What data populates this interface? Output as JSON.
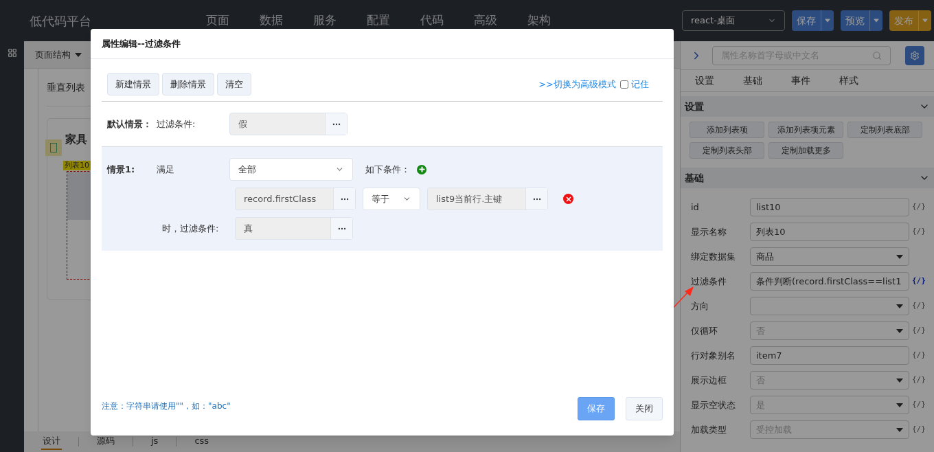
{
  "app": {
    "logo": "低代码平台",
    "nav": [
      "页面",
      "数据",
      "服务",
      "配置",
      "代码",
      "高级",
      "架构"
    ],
    "target_select": "react-桌面",
    "actions": [
      {
        "label": "保存",
        "kind": "primary"
      },
      {
        "label": "预览",
        "kind": "primary"
      },
      {
        "label": "发布",
        "kind": "warning"
      }
    ]
  },
  "toolbar": {
    "structure_menu": "页面结构"
  },
  "canvas": {
    "title": "垂直列表",
    "card_title": "家具",
    "list_tag": "列表10"
  },
  "bottom_tabs": [
    {
      "label": "设计",
      "selected": true
    },
    {
      "label": "源码",
      "selected": false
    },
    {
      "label": "js",
      "selected": false
    },
    {
      "label": "css",
      "selected": false
    }
  ],
  "property_panel": {
    "search": {
      "placeholder": "属性名称首字母或中文名"
    },
    "tabs": [
      "设置",
      "基础",
      "事件",
      "样式"
    ],
    "sections": [
      {
        "title": "设置",
        "expanded": true,
        "buttons": [
          "添加列表项",
          "添加列表项元素",
          "定制列表底部",
          "定制列表头部",
          "定制加载更多"
        ]
      },
      {
        "title": "基础",
        "expanded": true,
        "properties": [
          {
            "label": "id",
            "kind": "input",
            "value": "list10",
            "disabled": false,
            "binding": {
              "text": "{/}",
              "active": false
            }
          },
          {
            "label": "显示名称",
            "kind": "input",
            "value": "列表10",
            "disabled": false,
            "binding": {
              "text": "{/}",
              "active": false
            }
          },
          {
            "label": "绑定数据集",
            "kind": "select",
            "value": "商品",
            "disabled": false
          },
          {
            "label": "过滤条件",
            "kind": "input",
            "value": "条件判断(record.firstClass==list1",
            "disabled": false,
            "binding": {
              "text": "{/}",
              "active": true
            }
          },
          {
            "label": "方向",
            "kind": "select",
            "disabled": false,
            "binding": {
              "text": "{/}",
              "active": false
            }
          },
          {
            "label": "仅循环",
            "kind": "select",
            "value": "否",
            "disabled": true,
            "binding": {
              "text": "{/}",
              "active": false
            }
          },
          {
            "label": "行对象别名",
            "kind": "input",
            "value": "item7",
            "disabled": false,
            "binding": {
              "text": "{/}",
              "active": false
            }
          },
          {
            "label": "展示边框",
            "kind": "select",
            "value": "否",
            "disabled": true,
            "binding": {
              "text": "{/}",
              "active": false
            }
          },
          {
            "label": "显示空状态",
            "kind": "select",
            "value": "是",
            "disabled": true,
            "binding": {
              "text": "{/}",
              "active": false
            }
          },
          {
            "label": "加载类型",
            "kind": "select",
            "value": "受控加载",
            "disabled": true,
            "binding": {
              "text": "{/}",
              "active": false
            }
          }
        ]
      }
    ]
  },
  "dialog": {
    "title": "属性编辑--过滤条件",
    "toolbar_buttons": [
      "新建情景",
      "删除情景",
      "清空"
    ],
    "advanced_link": ">>切换为高级模式",
    "remember": {
      "label": "记住",
      "checked": false
    },
    "default_scenario": {
      "label": "默认情景：",
      "field_label": "过滤条件:",
      "value": "假"
    },
    "scenarios": [
      {
        "label": "情景1:",
        "match_label": "满足",
        "match": "全部",
        "conditions_label": "如下条件：",
        "conditions": [
          {
            "left": "record.firstClass",
            "operator": "等于",
            "right": "list9当前行.主键"
          }
        ],
        "result_label": "时，过滤条件:",
        "result": "真"
      }
    ],
    "note": "注意：字符串请使用\"\"，如：\"abc\"",
    "buttons": [
      {
        "label": "保存",
        "kind": "primary"
      },
      {
        "label": "关闭",
        "kind": "default"
      }
    ]
  }
}
